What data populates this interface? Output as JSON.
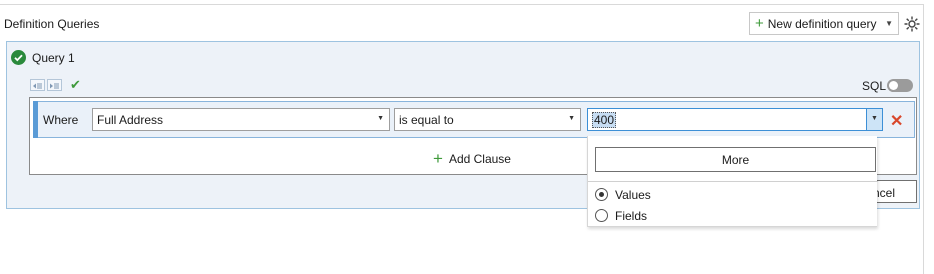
{
  "header": {
    "title": "Definition Queries",
    "new_query_label": "New definition query"
  },
  "query": {
    "title": "Query 1",
    "sql_label": "SQL",
    "sql_toggle_on": false
  },
  "clause": {
    "where_label": "Where",
    "field_value": "Full Address",
    "operator_value": "is equal to",
    "value_text": "400"
  },
  "add_clause_label": "Add Clause",
  "cancel_label": "ncel",
  "dropdown": {
    "more_label": "More",
    "options": [
      {
        "label": "Values",
        "checked": true
      },
      {
        "label": "Fields",
        "checked": false
      }
    ]
  },
  "colors": {
    "accent": "#3c8fd6",
    "success": "#2a8a3c",
    "delete": "#d9472b"
  }
}
